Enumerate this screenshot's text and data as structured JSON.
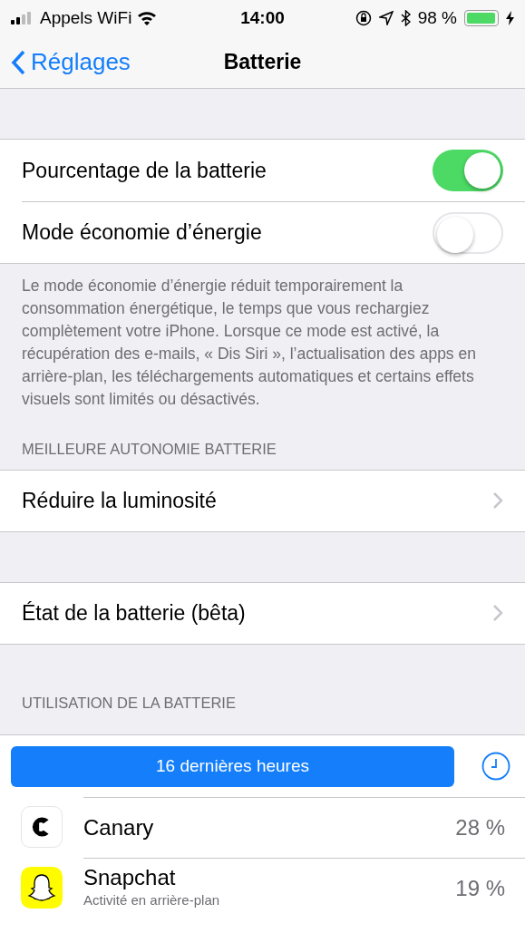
{
  "status_bar": {
    "carrier": "Appels WiFi",
    "time": "14:00",
    "battery_text": "98 %"
  },
  "nav": {
    "back": "Réglages",
    "title": "Batterie"
  },
  "toggles": [
    {
      "label": "Pourcentage de la batterie",
      "on": true
    },
    {
      "label": "Mode économie d’énergie",
      "on": false
    }
  ],
  "toggles_footer": "Le mode économie d’énergie réduit temporairement la consommation énergétique, le temps que vous rechargiez complètement votre iPhone. Lorsque ce mode est activé, la récupération des e-mails, « Dis Siri », l’actualisation des apps en arrière-plan, les téléchargements automatiques et certains effets visuels sont limités ou désactivés.",
  "autonomy_header": "MEILLEURE AUTONOMIE BATTERIE",
  "autonomy_rows": [
    {
      "label": "Réduire la luminosité"
    }
  ],
  "health_rows": [
    {
      "label": "État de la batterie (bêta)"
    }
  ],
  "usage_header": "UTILISATION DE LA BATTERIE",
  "period_button": "16 dernières heures",
  "apps": [
    {
      "name": "Canary",
      "percent": "28 %",
      "kind": "canary"
    },
    {
      "name": "Snapchat",
      "subtitle": "Activité en arrière-plan",
      "percent": "19 %",
      "kind": "snapchat"
    }
  ]
}
